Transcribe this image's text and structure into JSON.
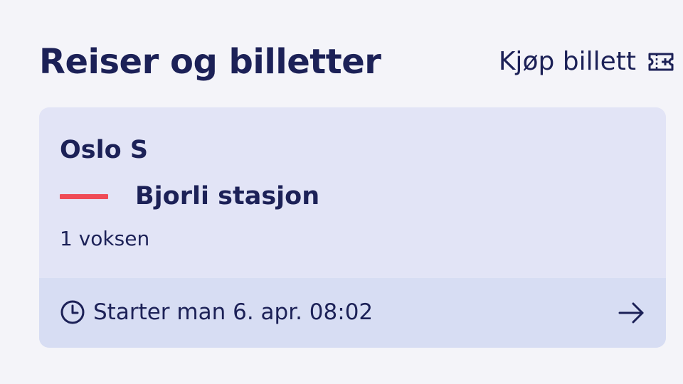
{
  "header": {
    "title": "Reiser og billetter",
    "buy_ticket_label": "Kjøp billett",
    "buy_ticket_icon": "ticket-plus-icon"
  },
  "trip": {
    "from": "Oslo S",
    "to": "Bjorli stasjon",
    "passengers": "1 voksen",
    "start_text": "Starter man 6. apr. 08:02",
    "clock_icon": "clock-icon",
    "arrow_icon": "arrow-right-icon"
  },
  "colors": {
    "background": "#f4f4f9",
    "text": "#1c2157",
    "card": "#e2e4f6",
    "card_footer": "#d7ddf3",
    "route_line": "#ef4b56"
  }
}
